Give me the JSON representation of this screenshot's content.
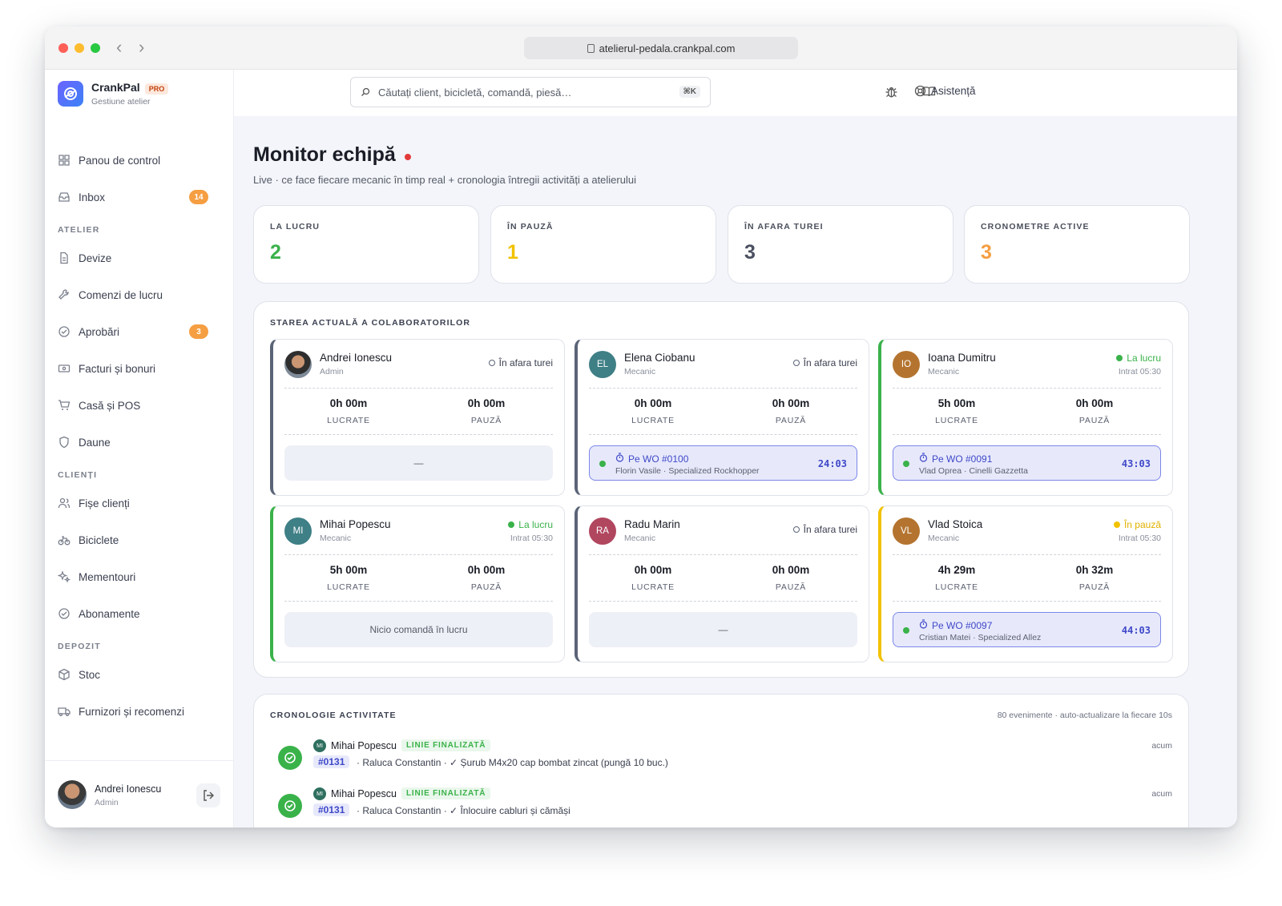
{
  "browser": {
    "url": "atelierul-pedala.crankpal.com"
  },
  "brand": {
    "name": "CrankPal",
    "badge": "PRO",
    "subtitle": "Gestiune atelier"
  },
  "search": {
    "placeholder": "Căutați client, bicicletă, comandă, piesă…",
    "shortcut": "⌘K"
  },
  "header": {
    "help_label": "Asistență",
    "icons": [
      "bug-icon",
      "book-icon",
      "help-icon"
    ]
  },
  "sidebar": {
    "top": [
      {
        "label": "Panou de control",
        "icon": "dashboard-icon"
      },
      {
        "label": "Inbox",
        "icon": "inbox-icon",
        "badge": "14"
      }
    ],
    "sections": [
      {
        "title": "ATELIER",
        "items": [
          {
            "label": "Devize",
            "icon": "document-icon"
          },
          {
            "label": "Comenzi de lucru",
            "icon": "wrench-icon"
          },
          {
            "label": "Aprobări",
            "icon": "check-circle-icon",
            "badge": "3"
          },
          {
            "label": "Facturi și bonuri",
            "icon": "receipt-icon"
          },
          {
            "label": "Casă și POS",
            "icon": "cart-icon"
          },
          {
            "label": "Daune",
            "icon": "shield-icon"
          }
        ]
      },
      {
        "title": "CLIENȚI",
        "items": [
          {
            "label": "Fișe clienți",
            "icon": "users-icon"
          },
          {
            "label": "Biciclete",
            "icon": "bike-icon"
          },
          {
            "label": "Mementouri",
            "icon": "sparkle-icon"
          },
          {
            "label": "Abonamente",
            "icon": "check-circle-icon"
          }
        ]
      },
      {
        "title": "DEPOZIT",
        "items": [
          {
            "label": "Stoc",
            "icon": "box-icon"
          },
          {
            "label": "Furnizori și recomenzi",
            "icon": "truck-icon"
          }
        ]
      }
    ],
    "user": {
      "name": "Andrei Ionescu",
      "role": "Admin"
    }
  },
  "page": {
    "title": "Monitor echipă",
    "subtitle": "Live · ce face fiecare mecanic în timp real + cronologia întregii activități a atelierului"
  },
  "stats": [
    {
      "label": "LA LUCRU",
      "value": "2",
      "color": "#3ab24a"
    },
    {
      "label": "ÎN PAUZĂ",
      "value": "1",
      "color": "#f2c200"
    },
    {
      "label": "ÎN AFARA TUREI",
      "value": "3",
      "color": "#4a5060"
    },
    {
      "label": "CRONOMETRE ACTIVE",
      "value": "3",
      "color": "#f59e42"
    }
  ],
  "team": {
    "title": "STAREA ACTUALĂ A COLABORATORILOR",
    "worked_label": "LUCRATE",
    "pause_label": "PAUZĂ",
    "members": [
      {
        "name": "Andrei Ionescu",
        "role": "Admin",
        "initials": "",
        "avatar_color": "",
        "status": "În afara turei",
        "status_kind": "off",
        "entered": "",
        "worked": "0h 00m",
        "paused": "0h 00m",
        "slot_text": "—"
      },
      {
        "name": "Elena Ciobanu",
        "role": "Mecanic",
        "initials": "EL",
        "avatar_color": "#3f7f86",
        "status": "În afara turei",
        "status_kind": "off",
        "entered": "",
        "worked": "0h 00m",
        "paused": "0h 00m",
        "wo": "Pe WO #0100",
        "wo_desc": "Florin Vasile · Specialized Rockhopper",
        "timer": "24:03"
      },
      {
        "name": "Ioana Dumitru",
        "role": "Mecanic",
        "initials": "IO",
        "avatar_color": "#b4742f",
        "status": "La lucru",
        "status_kind": "working",
        "entered": "Intrat 05:30",
        "worked": "5h 00m",
        "paused": "0h 00m",
        "wo": "Pe WO #0091",
        "wo_desc": "Vlad Oprea · Cinelli Gazzetta",
        "timer": "43:03"
      },
      {
        "name": "Mihai Popescu",
        "role": "Mecanic",
        "initials": "MI",
        "avatar_color": "#3f7f86",
        "status": "La lucru",
        "status_kind": "working",
        "entered": "Intrat 05:30",
        "worked": "5h 00m",
        "paused": "0h 00m",
        "slot_text": "Nicio comandă în lucru"
      },
      {
        "name": "Radu Marin",
        "role": "Mecanic",
        "initials": "RA",
        "avatar_color": "#b1465f",
        "status": "În afara turei",
        "status_kind": "off",
        "entered": "",
        "worked": "0h 00m",
        "paused": "0h 00m",
        "slot_text": "—"
      },
      {
        "name": "Vlad Stoica",
        "role": "Mecanic",
        "initials": "VL",
        "avatar_color": "#b4742f",
        "status": "În pauză",
        "status_kind": "pause",
        "entered": "Intrat 05:30",
        "worked": "4h 29m",
        "paused": "0h 32m",
        "wo": "Pe WO #0097",
        "wo_desc": "Cristian Matei · Specialized Allez",
        "timer": "44:03"
      }
    ]
  },
  "timeline": {
    "title": "CRONOLOGIE ACTIVITATE",
    "meta": "80 evenimente · auto-actualizare la fiecare 10s",
    "events": [
      {
        "initials": "MI",
        "name": "Mihai Popescu",
        "tag": "LINIE FINALIZATĂ",
        "wo": "#0131",
        "text": "· Raluca Constantin · ✓ Șurub M4x20 cap bombat zincat (pungă 10 buc.)",
        "time": "acum"
      },
      {
        "initials": "MI",
        "name": "Mihai Popescu",
        "tag": "LINIE FINALIZATĂ",
        "wo": "#0131",
        "text": "· Raluca Constantin · ✓ Înlocuire cabluri și cămăși",
        "time": "acum"
      }
    ]
  }
}
